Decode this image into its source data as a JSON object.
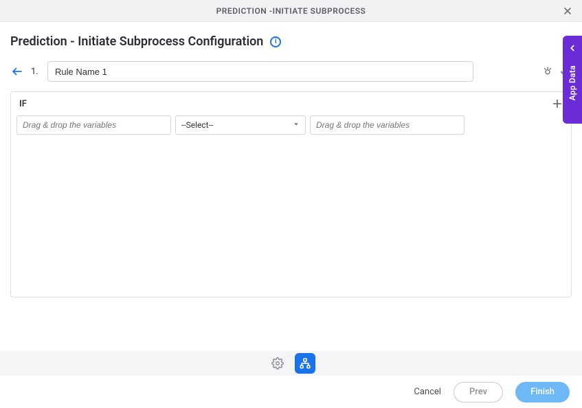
{
  "titlebar": {
    "text": "PREDICTION -INITIATE SUBPROCESS"
  },
  "page": {
    "title": "Prediction - Initiate Subprocess Configuration"
  },
  "rule": {
    "index": "1.",
    "name": "Rule Name 1"
  },
  "condition": {
    "header": "IF",
    "left_placeholder": "Drag & drop the variables",
    "operator_label": "--Select--",
    "right_placeholder": "Drag & drop the variables"
  },
  "side_tab": {
    "label": "App Data"
  },
  "footer": {
    "cancel": "Cancel",
    "prev": "Prev",
    "finish": "Finish"
  }
}
